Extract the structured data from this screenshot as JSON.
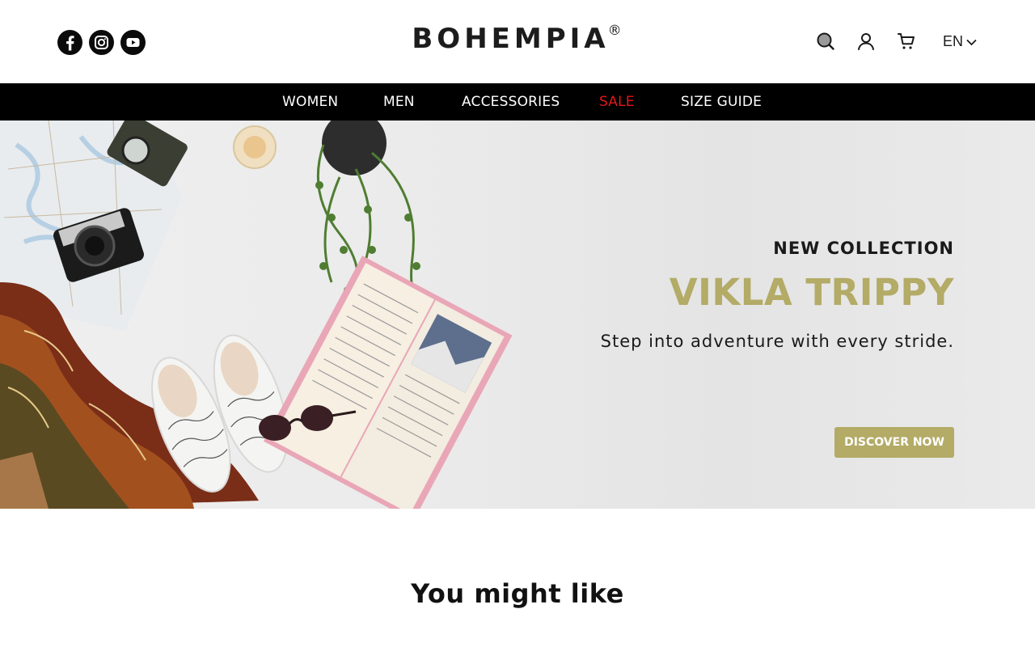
{
  "header": {
    "brand": "BOHEMPIA",
    "brand_mark": "®",
    "socials": [
      {
        "name": "facebook",
        "icon": "facebook-icon"
      },
      {
        "name": "instagram",
        "icon": "instagram-icon"
      },
      {
        "name": "youtube",
        "icon": "youtube-icon"
      }
    ],
    "utilities": {
      "search_icon": "search-icon",
      "account_icon": "user-icon",
      "cart_icon": "cart-icon",
      "language": "EN"
    }
  },
  "nav": {
    "items": [
      {
        "label": "WOMEN"
      },
      {
        "label": "MEN"
      },
      {
        "label": "ACCESSORIES"
      },
      {
        "label": "SALE",
        "color": "#e3161b"
      },
      {
        "label": "SIZE GUIDE"
      }
    ]
  },
  "hero": {
    "eyebrow": "NEW COLLECTION",
    "title": "VIKLA TRIPPY",
    "subtitle": "Step into adventure with every stride.",
    "cta": "DISCOVER NOW",
    "accent_color": "#b3ab66"
  },
  "section": {
    "title": "You might like"
  }
}
